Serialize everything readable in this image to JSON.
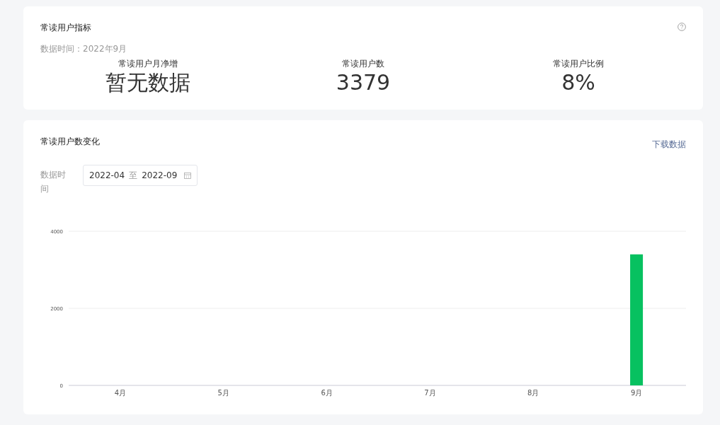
{
  "metrics_card": {
    "title": "常读用户指标",
    "data_time": "数据时间：2022年9月",
    "metrics": [
      {
        "label": "常读用户月净增",
        "value": "暂无数据"
      },
      {
        "label": "常读用户数",
        "value": "3379"
      },
      {
        "label": "常读用户比例",
        "value": "8%"
      }
    ]
  },
  "trend_card": {
    "title": "常读用户数变化",
    "download_link": "下载数据",
    "filter_label": "数据时间",
    "date_range": {
      "start": "2022-04",
      "separator": "至",
      "end": "2022-09"
    },
    "chart_data": {
      "type": "bar",
      "categories": [
        "4月",
        "5月",
        "6月",
        "7月",
        "8月",
        "9月"
      ],
      "series": [
        {
          "color": "#07c160",
          "values": [
            0,
            0,
            0,
            0,
            0,
            3400
          ]
        }
      ],
      "ylim": [
        0,
        4000
      ],
      "yticks": [
        0,
        2000,
        4000
      ]
    }
  }
}
